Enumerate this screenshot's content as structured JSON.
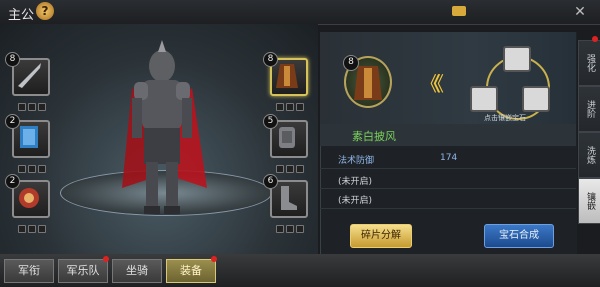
{
  "header": {
    "title": "主公",
    "help_symbol": "?",
    "currency_value": "",
    "close_symbol": "✕"
  },
  "colors": {
    "accent_gold": "#f1c53a",
    "item_name": "#7bd25a",
    "stat_blue": "#8fb5e8",
    "fuse_blue": "#3b78c6"
  },
  "slots": [
    {
      "level": "8",
      "name": "sword"
    },
    {
      "level": "2",
      "name": "book"
    },
    {
      "level": "2",
      "name": "amulet"
    },
    {
      "level": "8",
      "name": "cloak"
    },
    {
      "level": "5",
      "name": "armor"
    },
    {
      "level": "6",
      "name": "boots"
    }
  ],
  "detail": {
    "level": "8",
    "arrows": "《《",
    "hint": "点击镶嵌宝石",
    "item_name": "素白披风",
    "stat1_label": "法术防御",
    "stat1_value": "174",
    "stat2": "(未开启)",
    "stat3": "(未开启)",
    "dismantle": "碎片分解",
    "fuse": "宝石合成"
  },
  "side_tabs": [
    "强化",
    "进阶",
    "洗炼",
    "镶嵌"
  ],
  "bottom_tabs": [
    "军衔",
    "军乐队",
    "坐骑",
    "装备"
  ]
}
